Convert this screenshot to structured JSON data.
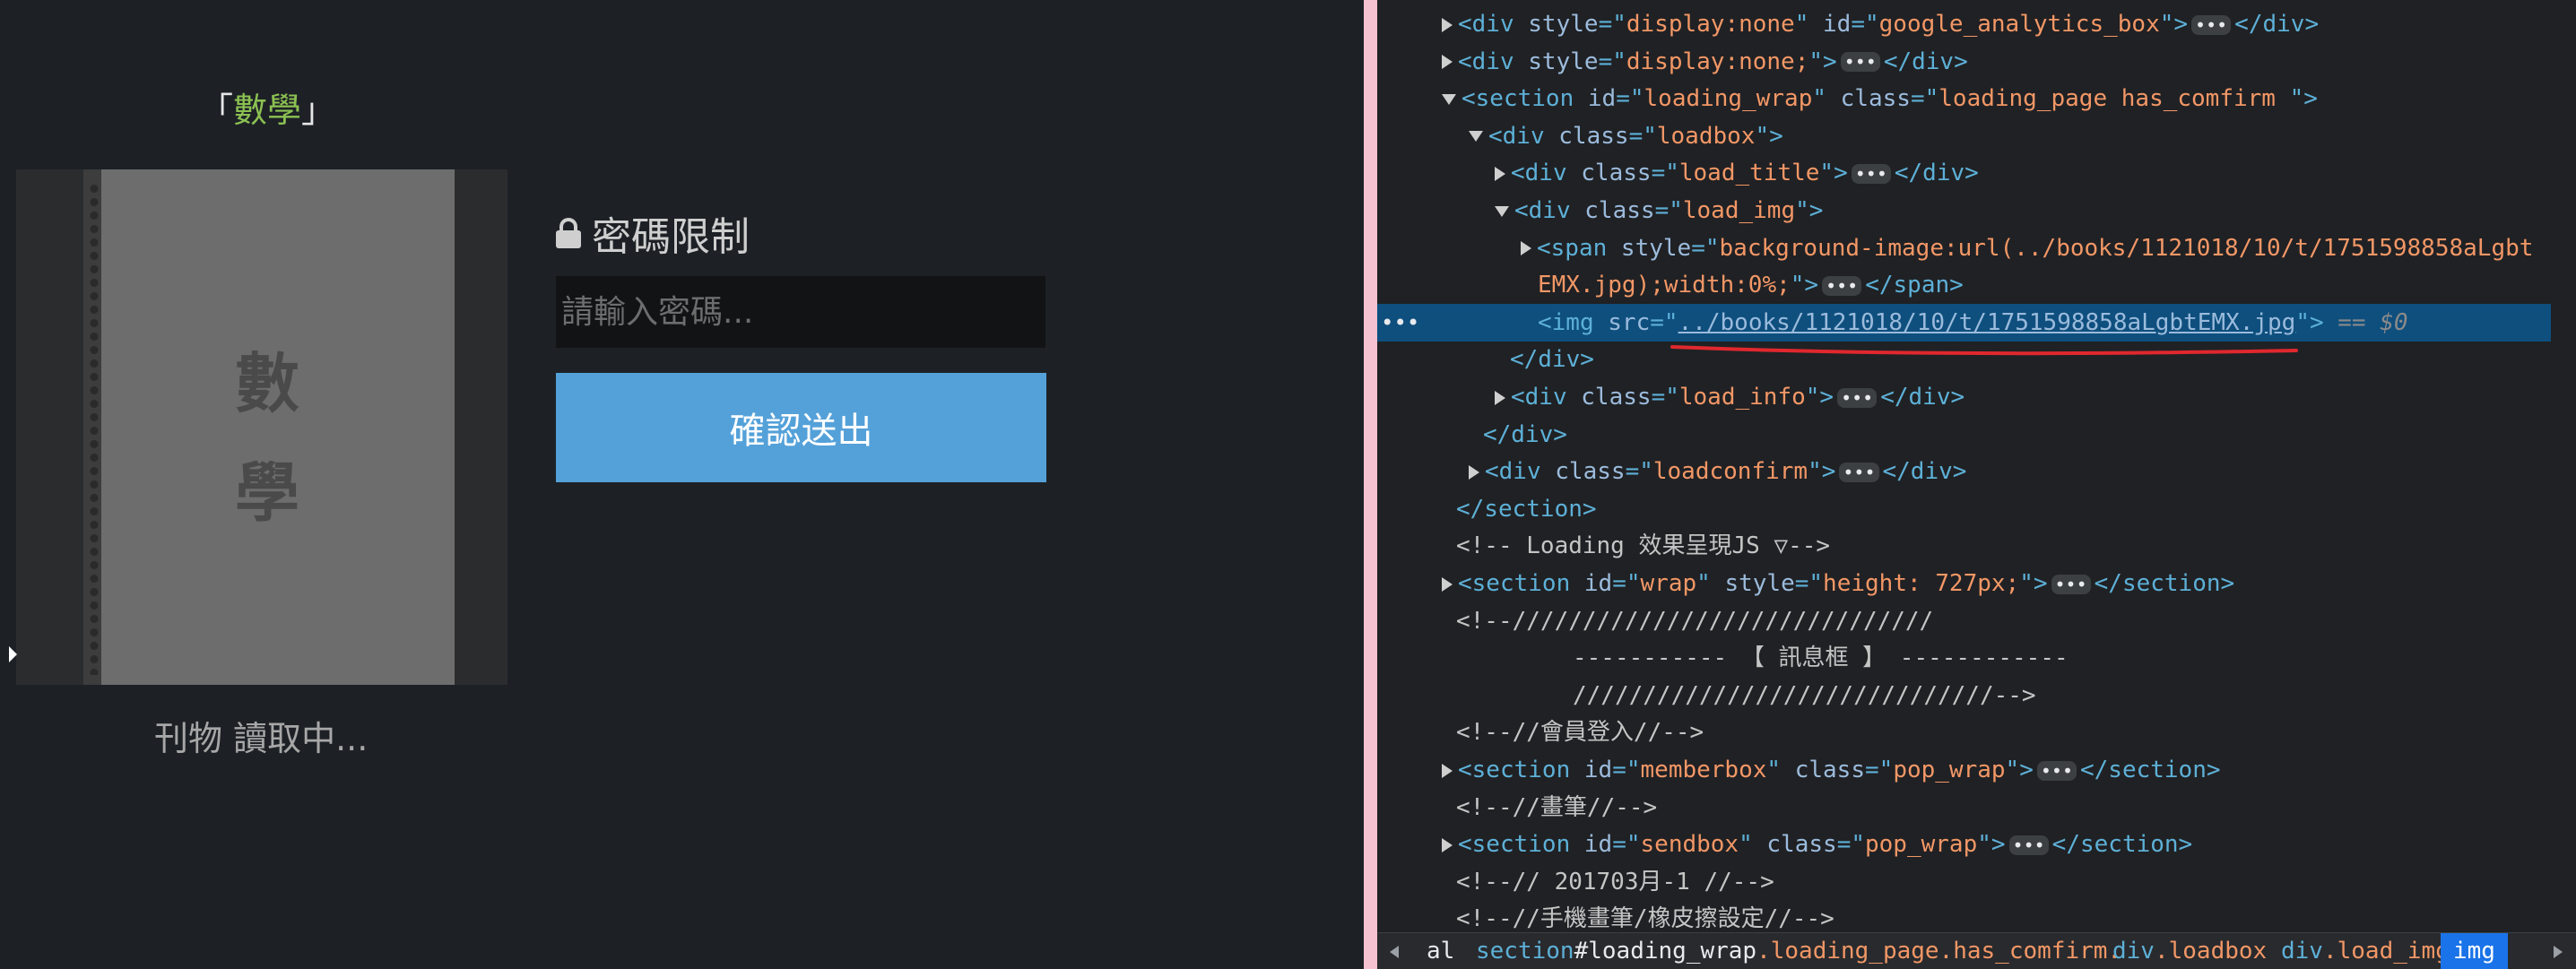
{
  "left_page": {
    "book_title": "數學",
    "bracket_open": "「",
    "bracket_close": "」",
    "cover_chars": [
      "數",
      "學"
    ],
    "loading_text": "刊物 讀取中...",
    "password_title": "密碼限制",
    "password_placeholder": "請輸入密碼...",
    "submit_label": "確認送出"
  },
  "devtools": {
    "lines": [
      {
        "segments": [
          [
            "tag",
            "<div "
          ],
          [
            "an",
            "style"
          ],
          [
            "tag",
            "=\""
          ],
          [
            "av",
            "display:none"
          ],
          [
            "tag",
            "\" "
          ],
          [
            "an",
            "id"
          ],
          [
            "tag",
            "=\""
          ],
          [
            "av",
            "google_analytics_box"
          ],
          [
            "tag",
            "\">"
          ],
          [
            "ell",
            "•••"
          ],
          [
            "tag",
            "</div>"
          ]
        ]
      },
      {
        "segments": [
          [
            "tag",
            "<div "
          ],
          [
            "an",
            "style"
          ],
          [
            "tag",
            "=\""
          ],
          [
            "av",
            "display:none;"
          ],
          [
            "tag",
            "\">"
          ],
          [
            "ell",
            "•••"
          ],
          [
            "tag",
            "</div>"
          ]
        ]
      },
      {
        "segments": [
          [
            "tag",
            "<section "
          ],
          [
            "an",
            "id"
          ],
          [
            "tag",
            "=\""
          ],
          [
            "av",
            "loading_wrap"
          ],
          [
            "tag",
            "\" "
          ],
          [
            "an",
            "class"
          ],
          [
            "tag",
            "=\""
          ],
          [
            "av",
            "loading_page has_comfirm "
          ],
          [
            "tag",
            "\">"
          ]
        ]
      },
      {
        "segments": [
          [
            "tag",
            "<div "
          ],
          [
            "an",
            "class"
          ],
          [
            "tag",
            "=\""
          ],
          [
            "av",
            "loadbox"
          ],
          [
            "tag",
            "\">"
          ]
        ]
      },
      {
        "segments": [
          [
            "tag",
            "<div "
          ],
          [
            "an",
            "class"
          ],
          [
            "tag",
            "=\""
          ],
          [
            "av",
            "load_title"
          ],
          [
            "tag",
            "\">"
          ],
          [
            "ell",
            "•••"
          ],
          [
            "tag",
            "</div>"
          ]
        ]
      },
      {
        "segments": [
          [
            "tag",
            "<div "
          ],
          [
            "an",
            "class"
          ],
          [
            "tag",
            "=\""
          ],
          [
            "av",
            "load_img"
          ],
          [
            "tag",
            "\">"
          ]
        ]
      },
      {
        "segments": [
          [
            "tag",
            "<span "
          ],
          [
            "an",
            "style"
          ],
          [
            "tag",
            "=\""
          ],
          [
            "av",
            "background-image:url(../books/1121018/10/t/1751598858aLgbt"
          ]
        ]
      },
      {
        "segments": [
          [
            "av",
            "EMX.jpg);width:0%;"
          ],
          [
            "tag",
            "\">"
          ],
          [
            "ell",
            "•••"
          ],
          [
            "tag",
            "</span>"
          ]
        ]
      },
      {
        "segments": [
          [
            "tag",
            "<img "
          ],
          [
            "an",
            "src"
          ],
          [
            "tag",
            "=\""
          ],
          [
            "url",
            "../books/1121018/10/t/1751598858aLgbtEMX.jpg"
          ],
          [
            "tag",
            "\">"
          ],
          [
            "dim",
            " == $0"
          ]
        ]
      },
      {
        "segments": [
          [
            "tag",
            "</div>"
          ]
        ]
      },
      {
        "segments": [
          [
            "tag",
            "<div "
          ],
          [
            "an",
            "class"
          ],
          [
            "tag",
            "=\""
          ],
          [
            "av",
            "load_info"
          ],
          [
            "tag",
            "\">"
          ],
          [
            "ell",
            "•••"
          ],
          [
            "tag",
            "</div>"
          ]
        ]
      },
      {
        "segments": [
          [
            "tag",
            "</div>"
          ]
        ]
      },
      {
        "segments": [
          [
            "tag",
            "<div "
          ],
          [
            "an",
            "class"
          ],
          [
            "tag",
            "=\""
          ],
          [
            "av",
            "loadconfirm"
          ],
          [
            "tag",
            "\">"
          ],
          [
            "ell",
            "•••"
          ],
          [
            "tag",
            "</div>"
          ]
        ]
      },
      {
        "segments": [
          [
            "tag",
            "</section>"
          ]
        ]
      },
      {
        "segments": [
          [
            "cm",
            "<!-- Loading 效果呈現JS ▽-->"
          ]
        ]
      },
      {
        "segments": [
          [
            "tag",
            "<section "
          ],
          [
            "an",
            "id"
          ],
          [
            "tag",
            "=\""
          ],
          [
            "av",
            "wrap"
          ],
          [
            "tag",
            "\" "
          ],
          [
            "an",
            "style"
          ],
          [
            "tag",
            "=\""
          ],
          [
            "av",
            "height: 727px;"
          ],
          [
            "tag",
            "\">"
          ],
          [
            "ell",
            "•••"
          ],
          [
            "tag",
            "</section>"
          ]
        ]
      },
      {
        "segments": [
          [
            "cm",
            "<!--//////////////////////////////"
          ]
        ]
      },
      {
        "segments": [
          [
            "cm",
            "----------- 【  訊息框 】 ------------"
          ]
        ]
      },
      {
        "segments": [
          [
            "cm",
            "//////////////////////////////-->"
          ]
        ]
      },
      {
        "segments": [
          [
            "cm",
            "<!--//會員登入//-->"
          ]
        ]
      },
      {
        "segments": [
          [
            "tag",
            "<section "
          ],
          [
            "an",
            "id"
          ],
          [
            "tag",
            "=\""
          ],
          [
            "av",
            "memberbox"
          ],
          [
            "tag",
            "\" "
          ],
          [
            "an",
            "class"
          ],
          [
            "tag",
            "=\""
          ],
          [
            "av",
            "pop_wrap"
          ],
          [
            "tag",
            "\">"
          ],
          [
            "ell",
            "•••"
          ],
          [
            "tag",
            "</section>"
          ]
        ]
      },
      {
        "segments": [
          [
            "cm",
            "<!--//畫筆//-->"
          ]
        ]
      },
      {
        "segments": [
          [
            "tag",
            "<section "
          ],
          [
            "an",
            "id"
          ],
          [
            "tag",
            "=\""
          ],
          [
            "av",
            "sendbox"
          ],
          [
            "tag",
            "\" "
          ],
          [
            "an",
            "class"
          ],
          [
            "tag",
            "=\""
          ],
          [
            "av",
            "pop_wrap"
          ],
          [
            "tag",
            "\">"
          ],
          [
            "ell",
            "•••"
          ],
          [
            "tag",
            "</section>"
          ]
        ]
      },
      {
        "segments": [
          [
            "cm",
            "<!--// 201703月-1 //-->"
          ]
        ]
      },
      {
        "segments": [
          [
            "cm",
            "<!--//手機畫筆/橡皮擦設定//-->"
          ]
        ]
      }
    ],
    "breadcrumbs": [
      [
        [
          "plain",
          "al"
        ]
      ],
      [
        [
          "el",
          "section"
        ],
        [
          "plain",
          "#loading_wrap"
        ],
        [
          "cls",
          ".loading_page.has_comfirm."
        ]
      ],
      [
        [
          "el",
          "div"
        ],
        [
          "cls",
          ".loadbox"
        ]
      ],
      [
        [
          "el",
          "div"
        ],
        [
          "cls",
          ".load_img"
        ]
      ],
      [
        [
          "el",
          "img"
        ]
      ]
    ],
    "selected_dots": "•••"
  }
}
